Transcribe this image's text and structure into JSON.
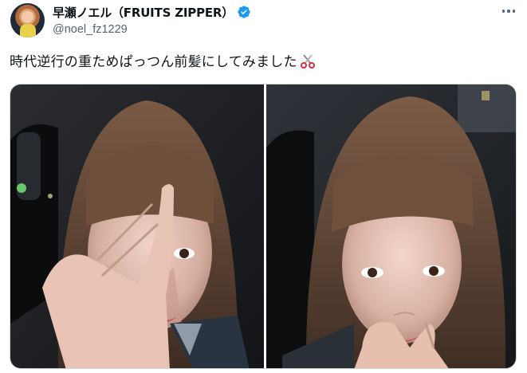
{
  "author": {
    "display_name": "早瀬ノエル（FRUITS ZIPPER）",
    "handle": "@noel_fz1229",
    "verified": true,
    "avatar_icon": "profile-avatar"
  },
  "tweet": {
    "text": "時代逆行の重ためぱっつん前髪にしてみました",
    "emoji_icon": "scissors-icon"
  },
  "menu": {
    "icon": "more-horizontal-icon"
  },
  "media": {
    "count": 2,
    "images": [
      {
        "icon": "selfie-photo-1"
      },
      {
        "icon": "selfie-photo-2"
      }
    ]
  },
  "colors": {
    "text": "#0f1419",
    "secondary": "#536471",
    "verified_blue": "#1d9bf0",
    "border": "#cfd9de"
  }
}
